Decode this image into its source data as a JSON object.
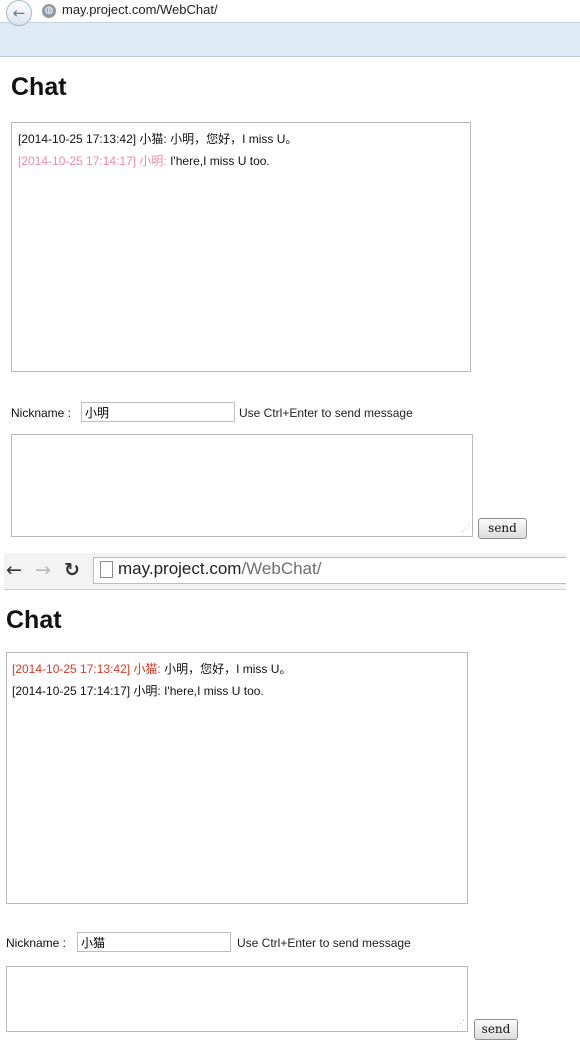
{
  "window1": {
    "url": "may.project.com/WebChat/",
    "title": "Chat",
    "messages": [
      {
        "meta": "[2014-10-25 17:13:42] 小猫:",
        "text": " 小明，您好，I miss U。"
      },
      {
        "meta": "[2014-10-25 17:14:17] 小明:",
        "text": " I'here,I miss U too."
      }
    ],
    "nickname_label": "Nickname :",
    "nickname_value": "小明",
    "hint": "Use Ctrl+Enter to send message",
    "send_label": "send"
  },
  "window2": {
    "url_domain": "may.project.com",
    "url_path": "/WebChat/",
    "title": "Chat",
    "messages": [
      {
        "meta": "[2014-10-25 17:13:42] 小猫:",
        "text": " 小明，您好，I miss U。"
      },
      {
        "meta": "[2014-10-25 17:14:17] 小明:",
        "text": " I'here,I miss U too."
      }
    ],
    "nickname_label": "Nickname :",
    "nickname_value": "小猫",
    "hint": "Use Ctrl+Enter to send message",
    "send_label": "send"
  },
  "icons": {
    "back": "←",
    "forward": "→",
    "reload": "↻",
    "globe": "◍"
  },
  "colors": {
    "own_message_pink": "#f08aa8",
    "own_message_red": "#d33a2a",
    "ie_toolbar_bg": "#dfeaf7"
  }
}
